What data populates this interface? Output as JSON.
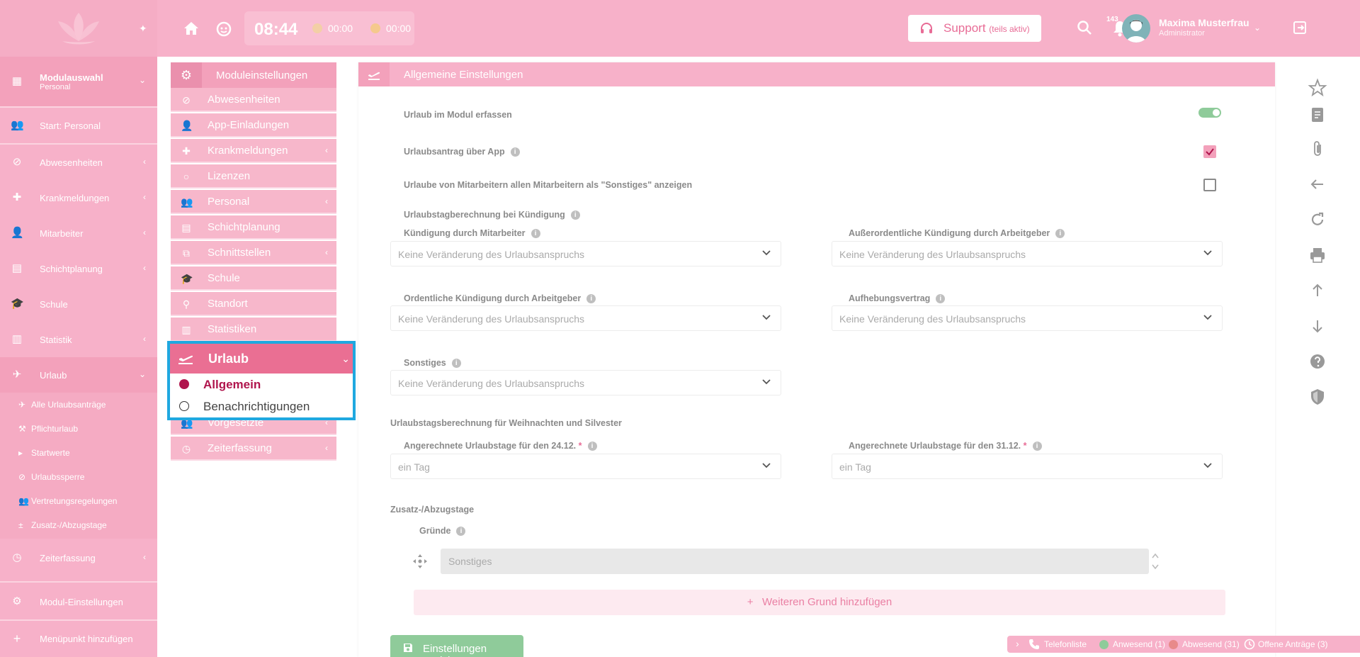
{
  "topbar": {
    "clock_time": "08:44",
    "timer_1": "00:00",
    "timer_2": "00:00",
    "support_label": "Support",
    "support_sub": "(teils aktiv)",
    "notification_count": "143",
    "user_name": "Maxima Musterfrau",
    "user_role": "Administrator"
  },
  "sidebar": {
    "module_select_title": "Modulauswahl",
    "module_select_sub": "Personal",
    "items": [
      {
        "label": "Start: Personal"
      },
      {
        "label": "Abwesenheiten"
      },
      {
        "label": "Krankmeldungen"
      },
      {
        "label": "Mitarbeiter"
      },
      {
        "label": "Schichtplanung"
      },
      {
        "label": "Schule"
      },
      {
        "label": "Statistik"
      },
      {
        "label": "Urlaub"
      }
    ],
    "sub_items": [
      {
        "label": "Alle Urlaubsanträge"
      },
      {
        "label": "Pflichturlaub"
      },
      {
        "label": "Startwerte"
      },
      {
        "label": "Urlaubssperre"
      },
      {
        "label": "Vertretungsregelungen"
      },
      {
        "label": "Zusatz-/Abzugstage"
      }
    ],
    "zeiterfassung": "Zeiterfassung",
    "modul_einstellungen": "Modul-Einstellungen",
    "add_menu_item": "Menüpunkt hinzufügen"
  },
  "module_menu": {
    "header": "Moduleinstellungen",
    "items": [
      {
        "label": "Abwesenheiten"
      },
      {
        "label": "App-Einladungen"
      },
      {
        "label": "Krankmeldungen"
      },
      {
        "label": "Lizenzen"
      },
      {
        "label": "Personal"
      },
      {
        "label": "Schichtplanung"
      },
      {
        "label": "Schnittstellen"
      },
      {
        "label": "Schule"
      },
      {
        "label": "Standort"
      },
      {
        "label": "Statistiken"
      }
    ],
    "hidden_item": "Vorgesetzte",
    "zeiterfassung": "Zeiterfassung",
    "popup": {
      "title": "Urlaub",
      "active": "Allgemein",
      "other": "Benachrichtigungen"
    }
  },
  "panel": {
    "title": "Allgemeine Einstellungen",
    "urlaub_im_modul": "Urlaub im Modul erfassen",
    "urlaubsantrag_app": "Urlaubsantrag über App",
    "urlaube_sonstiges": "Urlaube von Mitarbeitern allen Mitarbeitern als \"Sonstiges\" anzeigen",
    "kuendigung_title": "Urlaubstagberechnung bei Kündigung",
    "kuendigung_mitarbeiter": "Kündigung durch Mitarbeiter",
    "ausserordentliche": "Außerordentliche Kündigung durch Arbeitgeber",
    "ordentliche": "Ordentliche Kündigung durch Arbeitgeber",
    "aufhebungsvertrag": "Aufhebungsvertrag",
    "sonstiges": "Sonstiges",
    "no_change": "Keine Veränderung des Urlaubsanspruchs",
    "weihnachten_title": "Urlaubstagsberechnung für Weihnachten und Silvester",
    "tage_2412": "Angerechnete Urlaubstage für den 24.12.",
    "tage_3112": "Angerechnete Urlaubstage für den 31.12.",
    "ein_tag": "ein Tag",
    "zusatz_title": "Zusatz-/Abzugstage",
    "gruende": "Gründe",
    "reason_value": "Sonstiges",
    "add_reason": "Weiteren Grund hinzufügen",
    "save": "Einstellungen speichern"
  },
  "statusbar": {
    "telefonliste": "Telefonliste",
    "anwesend": "Anwesend (1)",
    "abwesend": "Abwesend (31)",
    "offene": "Offene Anträge (3)"
  },
  "colors": {
    "brand_pink": "#f7b1c9",
    "accent_pink": "#ea6f93",
    "highlight_blue": "#1fa8e0",
    "success_green": "#8fcb9a"
  }
}
